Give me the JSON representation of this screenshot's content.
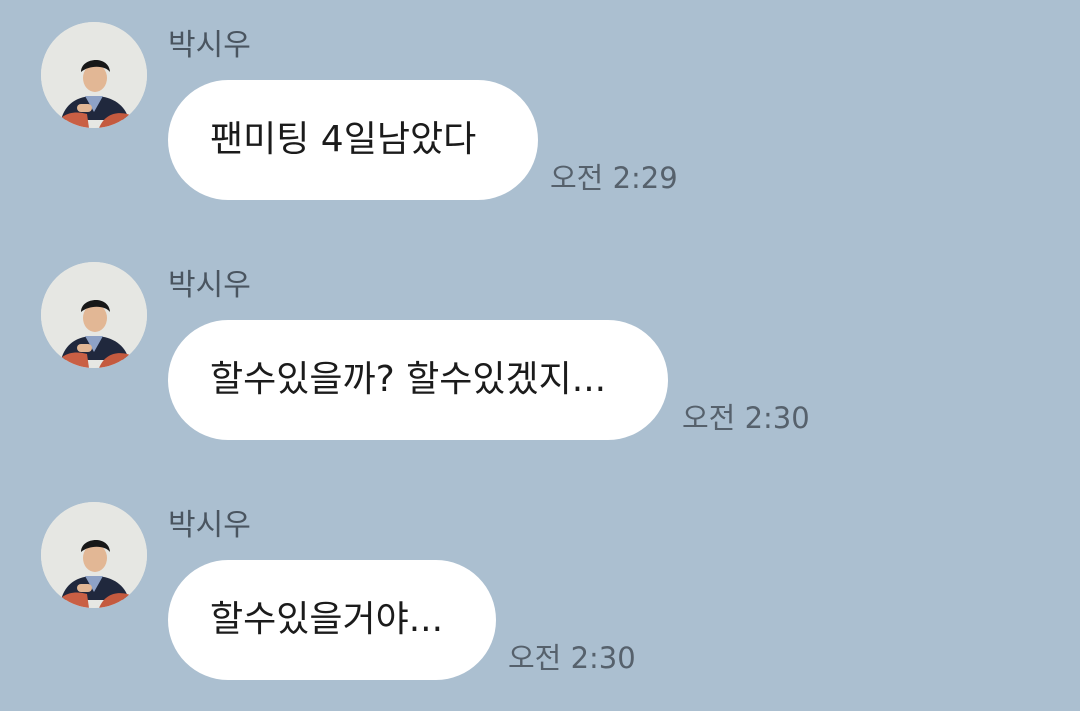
{
  "theme": {
    "background": "#abbfd0",
    "bubble": "#ffffff"
  },
  "messages": [
    {
      "sender": "박시우",
      "avatar": "profile-photo-icon",
      "text": "팬미팅 4일남았다",
      "time": "오전 2:29"
    },
    {
      "sender": "박시우",
      "avatar": "profile-photo-icon",
      "text": "할수있을까? 할수있겠지...",
      "time": "오전 2:30"
    },
    {
      "sender": "박시우",
      "avatar": "profile-photo-icon",
      "text": "할수있을거야...",
      "time": "오전 2:30"
    }
  ]
}
